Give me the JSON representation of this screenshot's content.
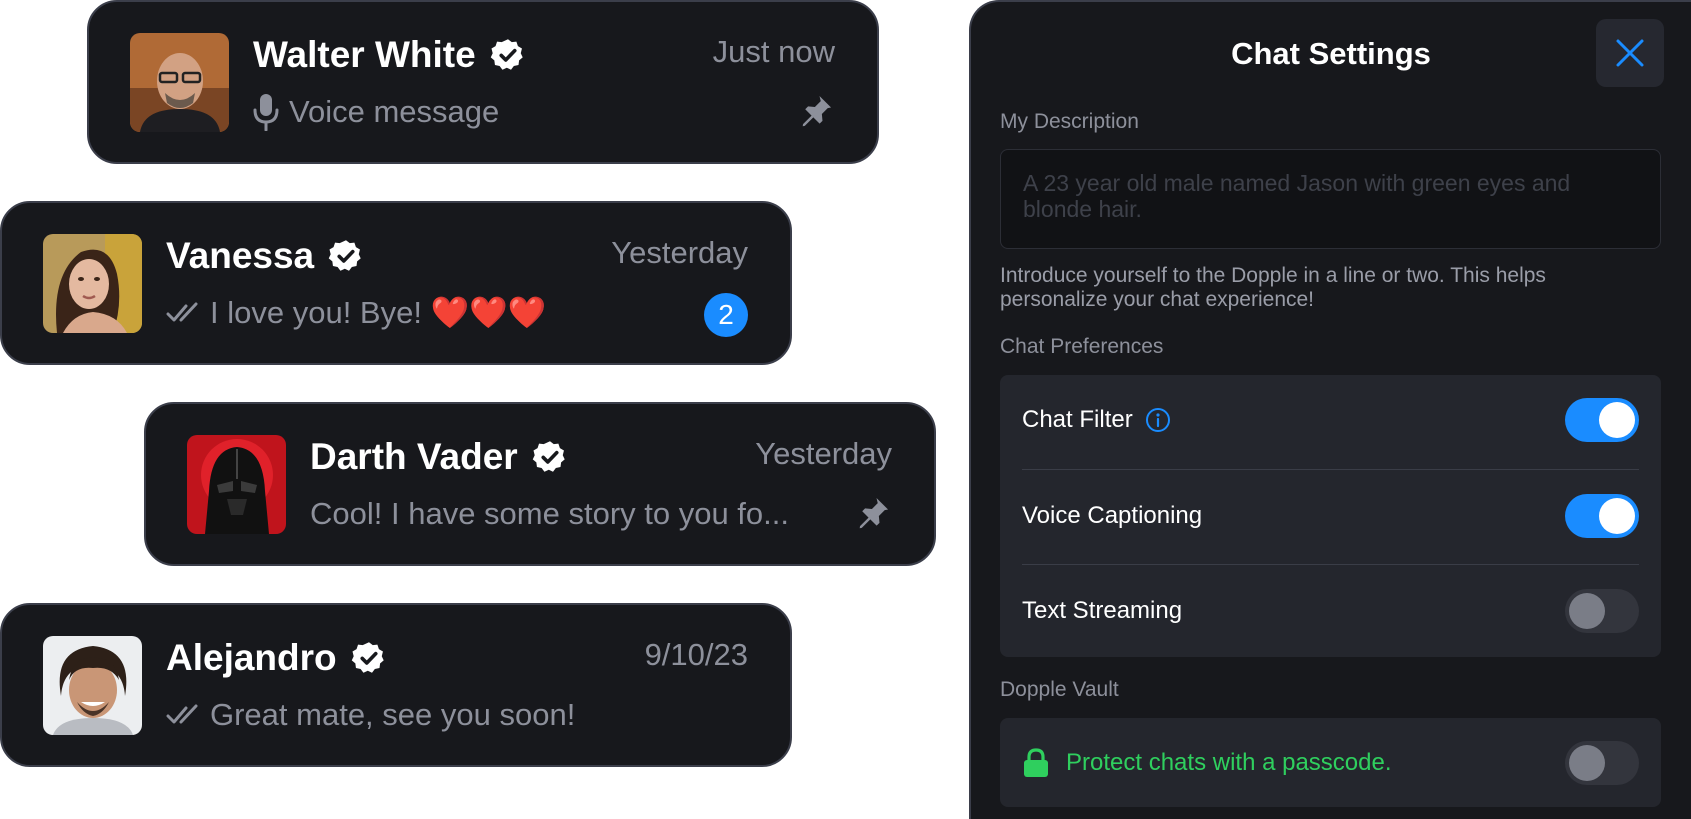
{
  "colors": {
    "card_background": "#17181c",
    "card_border": "#3b3e4a",
    "accent_blue": "#1a8cff",
    "success_green": "#2fcf5e",
    "muted_text": "#8d909b"
  },
  "chats": [
    {
      "name": "Walter White",
      "verified": true,
      "time": "Just now",
      "preview_icon": "microphone-icon",
      "preview": "Voice message",
      "pinned": true,
      "unread": null,
      "avatar": "walter-white-portrait"
    },
    {
      "name": "Vanessa",
      "verified": true,
      "time": "Yesterday",
      "preview_icon": "double-check-icon",
      "preview": "I love you! Bye! ❤️❤️❤️",
      "pinned": false,
      "unread": "2",
      "avatar": "vanessa-portrait"
    },
    {
      "name": "Darth Vader",
      "verified": true,
      "time": "Yesterday",
      "preview_icon": null,
      "preview": "Cool! I have some story to you fo...",
      "pinned": true,
      "unread": null,
      "avatar": "darth-vader-portrait"
    },
    {
      "name": "Alejandro",
      "verified": true,
      "time": "9/10/23",
      "preview_icon": "double-check-icon",
      "preview": "Great mate, see you soon!",
      "pinned": false,
      "unread": null,
      "avatar": "alejandro-portrait"
    }
  ],
  "settings": {
    "title": "Chat Settings",
    "close_icon": "close-icon",
    "description_label": "My Description",
    "description_placeholder": "A 23 year old male named Jason with green eyes and blonde hair.",
    "description_value": "",
    "description_help": "Introduce yourself to the Dopple in a line or two. This helps personalize your chat experience!",
    "preferences_label": "Chat Preferences",
    "preferences": [
      {
        "label": "Chat Filter",
        "info_icon": "info-icon",
        "enabled": true
      },
      {
        "label": "Voice Captioning",
        "enabled": true
      },
      {
        "label": "Text Streaming",
        "enabled": false
      }
    ],
    "vault_label": "Dopple Vault",
    "vault_icon": "lock-icon",
    "vault_option": "Protect chats with a passcode.",
    "vault_enabled": false
  }
}
